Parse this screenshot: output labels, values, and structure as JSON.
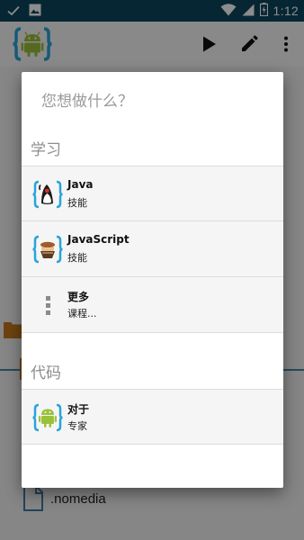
{
  "status_bar": {
    "time": "1:12",
    "icons": [
      "check-icon",
      "image-icon",
      "wifi-icon",
      "signal-icon",
      "battery-icon"
    ]
  },
  "app_bar": {
    "logo_icon": "android-code-logo-icon",
    "actions": [
      "play-icon",
      "pencil-icon",
      "more-vertical-icon"
    ]
  },
  "background": {
    "file_name": ".nomedia"
  },
  "dialog": {
    "title": "您想做什么？",
    "sections": [
      {
        "header": "学习",
        "items": [
          {
            "title": "Java",
            "subtitle": "技能",
            "icon": "java-duke-icon"
          },
          {
            "title": "JavaScript",
            "subtitle": "技能",
            "icon": "javascript-icon"
          },
          {
            "title": "更多",
            "subtitle": "课程...",
            "icon": "more-vertical-icon"
          }
        ]
      },
      {
        "header": "代码",
        "items": [
          {
            "title": "对于",
            "subtitle": "专家",
            "icon": "android-icon"
          }
        ]
      }
    ]
  },
  "colors": {
    "status_bar": "#0b4560",
    "accent": "#4a87a8",
    "brace": "#29a4d9",
    "android_green": "#9bc13b",
    "folder": "#c77a1e"
  }
}
